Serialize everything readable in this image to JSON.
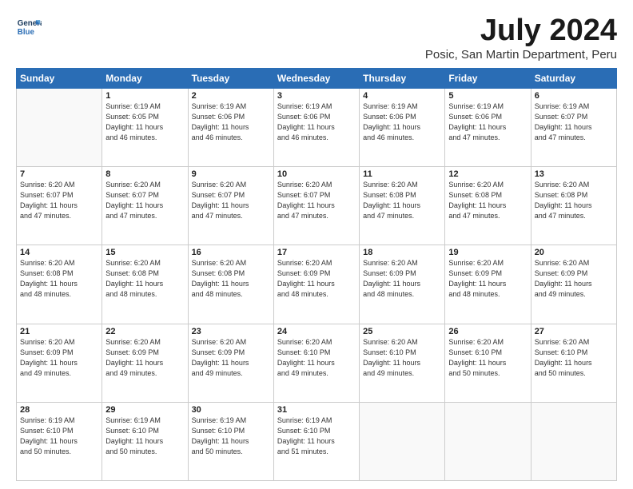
{
  "header": {
    "logo_line1": "General",
    "logo_line2": "Blue",
    "title": "July 2024",
    "subtitle": "Posic, San Martin Department, Peru"
  },
  "days_of_week": [
    "Sunday",
    "Monday",
    "Tuesday",
    "Wednesday",
    "Thursday",
    "Friday",
    "Saturday"
  ],
  "weeks": [
    [
      {
        "day": "",
        "info": ""
      },
      {
        "day": "1",
        "info": "Sunrise: 6:19 AM\nSunset: 6:05 PM\nDaylight: 11 hours\nand 46 minutes."
      },
      {
        "day": "2",
        "info": "Sunrise: 6:19 AM\nSunset: 6:06 PM\nDaylight: 11 hours\nand 46 minutes."
      },
      {
        "day": "3",
        "info": "Sunrise: 6:19 AM\nSunset: 6:06 PM\nDaylight: 11 hours\nand 46 minutes."
      },
      {
        "day": "4",
        "info": "Sunrise: 6:19 AM\nSunset: 6:06 PM\nDaylight: 11 hours\nand 46 minutes."
      },
      {
        "day": "5",
        "info": "Sunrise: 6:19 AM\nSunset: 6:06 PM\nDaylight: 11 hours\nand 47 minutes."
      },
      {
        "day": "6",
        "info": "Sunrise: 6:19 AM\nSunset: 6:07 PM\nDaylight: 11 hours\nand 47 minutes."
      }
    ],
    [
      {
        "day": "7",
        "info": "Sunrise: 6:20 AM\nSunset: 6:07 PM\nDaylight: 11 hours\nand 47 minutes."
      },
      {
        "day": "8",
        "info": "Sunrise: 6:20 AM\nSunset: 6:07 PM\nDaylight: 11 hours\nand 47 minutes."
      },
      {
        "day": "9",
        "info": "Sunrise: 6:20 AM\nSunset: 6:07 PM\nDaylight: 11 hours\nand 47 minutes."
      },
      {
        "day": "10",
        "info": "Sunrise: 6:20 AM\nSunset: 6:07 PM\nDaylight: 11 hours\nand 47 minutes."
      },
      {
        "day": "11",
        "info": "Sunrise: 6:20 AM\nSunset: 6:08 PM\nDaylight: 11 hours\nand 47 minutes."
      },
      {
        "day": "12",
        "info": "Sunrise: 6:20 AM\nSunset: 6:08 PM\nDaylight: 11 hours\nand 47 minutes."
      },
      {
        "day": "13",
        "info": "Sunrise: 6:20 AM\nSunset: 6:08 PM\nDaylight: 11 hours\nand 47 minutes."
      }
    ],
    [
      {
        "day": "14",
        "info": "Sunrise: 6:20 AM\nSunset: 6:08 PM\nDaylight: 11 hours\nand 48 minutes."
      },
      {
        "day": "15",
        "info": "Sunrise: 6:20 AM\nSunset: 6:08 PM\nDaylight: 11 hours\nand 48 minutes."
      },
      {
        "day": "16",
        "info": "Sunrise: 6:20 AM\nSunset: 6:08 PM\nDaylight: 11 hours\nand 48 minutes."
      },
      {
        "day": "17",
        "info": "Sunrise: 6:20 AM\nSunset: 6:09 PM\nDaylight: 11 hours\nand 48 minutes."
      },
      {
        "day": "18",
        "info": "Sunrise: 6:20 AM\nSunset: 6:09 PM\nDaylight: 11 hours\nand 48 minutes."
      },
      {
        "day": "19",
        "info": "Sunrise: 6:20 AM\nSunset: 6:09 PM\nDaylight: 11 hours\nand 48 minutes."
      },
      {
        "day": "20",
        "info": "Sunrise: 6:20 AM\nSunset: 6:09 PM\nDaylight: 11 hours\nand 49 minutes."
      }
    ],
    [
      {
        "day": "21",
        "info": "Sunrise: 6:20 AM\nSunset: 6:09 PM\nDaylight: 11 hours\nand 49 minutes."
      },
      {
        "day": "22",
        "info": "Sunrise: 6:20 AM\nSunset: 6:09 PM\nDaylight: 11 hours\nand 49 minutes."
      },
      {
        "day": "23",
        "info": "Sunrise: 6:20 AM\nSunset: 6:09 PM\nDaylight: 11 hours\nand 49 minutes."
      },
      {
        "day": "24",
        "info": "Sunrise: 6:20 AM\nSunset: 6:10 PM\nDaylight: 11 hours\nand 49 minutes."
      },
      {
        "day": "25",
        "info": "Sunrise: 6:20 AM\nSunset: 6:10 PM\nDaylight: 11 hours\nand 49 minutes."
      },
      {
        "day": "26",
        "info": "Sunrise: 6:20 AM\nSunset: 6:10 PM\nDaylight: 11 hours\nand 50 minutes."
      },
      {
        "day": "27",
        "info": "Sunrise: 6:20 AM\nSunset: 6:10 PM\nDaylight: 11 hours\nand 50 minutes."
      }
    ],
    [
      {
        "day": "28",
        "info": "Sunrise: 6:19 AM\nSunset: 6:10 PM\nDaylight: 11 hours\nand 50 minutes."
      },
      {
        "day": "29",
        "info": "Sunrise: 6:19 AM\nSunset: 6:10 PM\nDaylight: 11 hours\nand 50 minutes."
      },
      {
        "day": "30",
        "info": "Sunrise: 6:19 AM\nSunset: 6:10 PM\nDaylight: 11 hours\nand 50 minutes."
      },
      {
        "day": "31",
        "info": "Sunrise: 6:19 AM\nSunset: 6:10 PM\nDaylight: 11 hours\nand 51 minutes."
      },
      {
        "day": "",
        "info": ""
      },
      {
        "day": "",
        "info": ""
      },
      {
        "day": "",
        "info": ""
      }
    ]
  ]
}
